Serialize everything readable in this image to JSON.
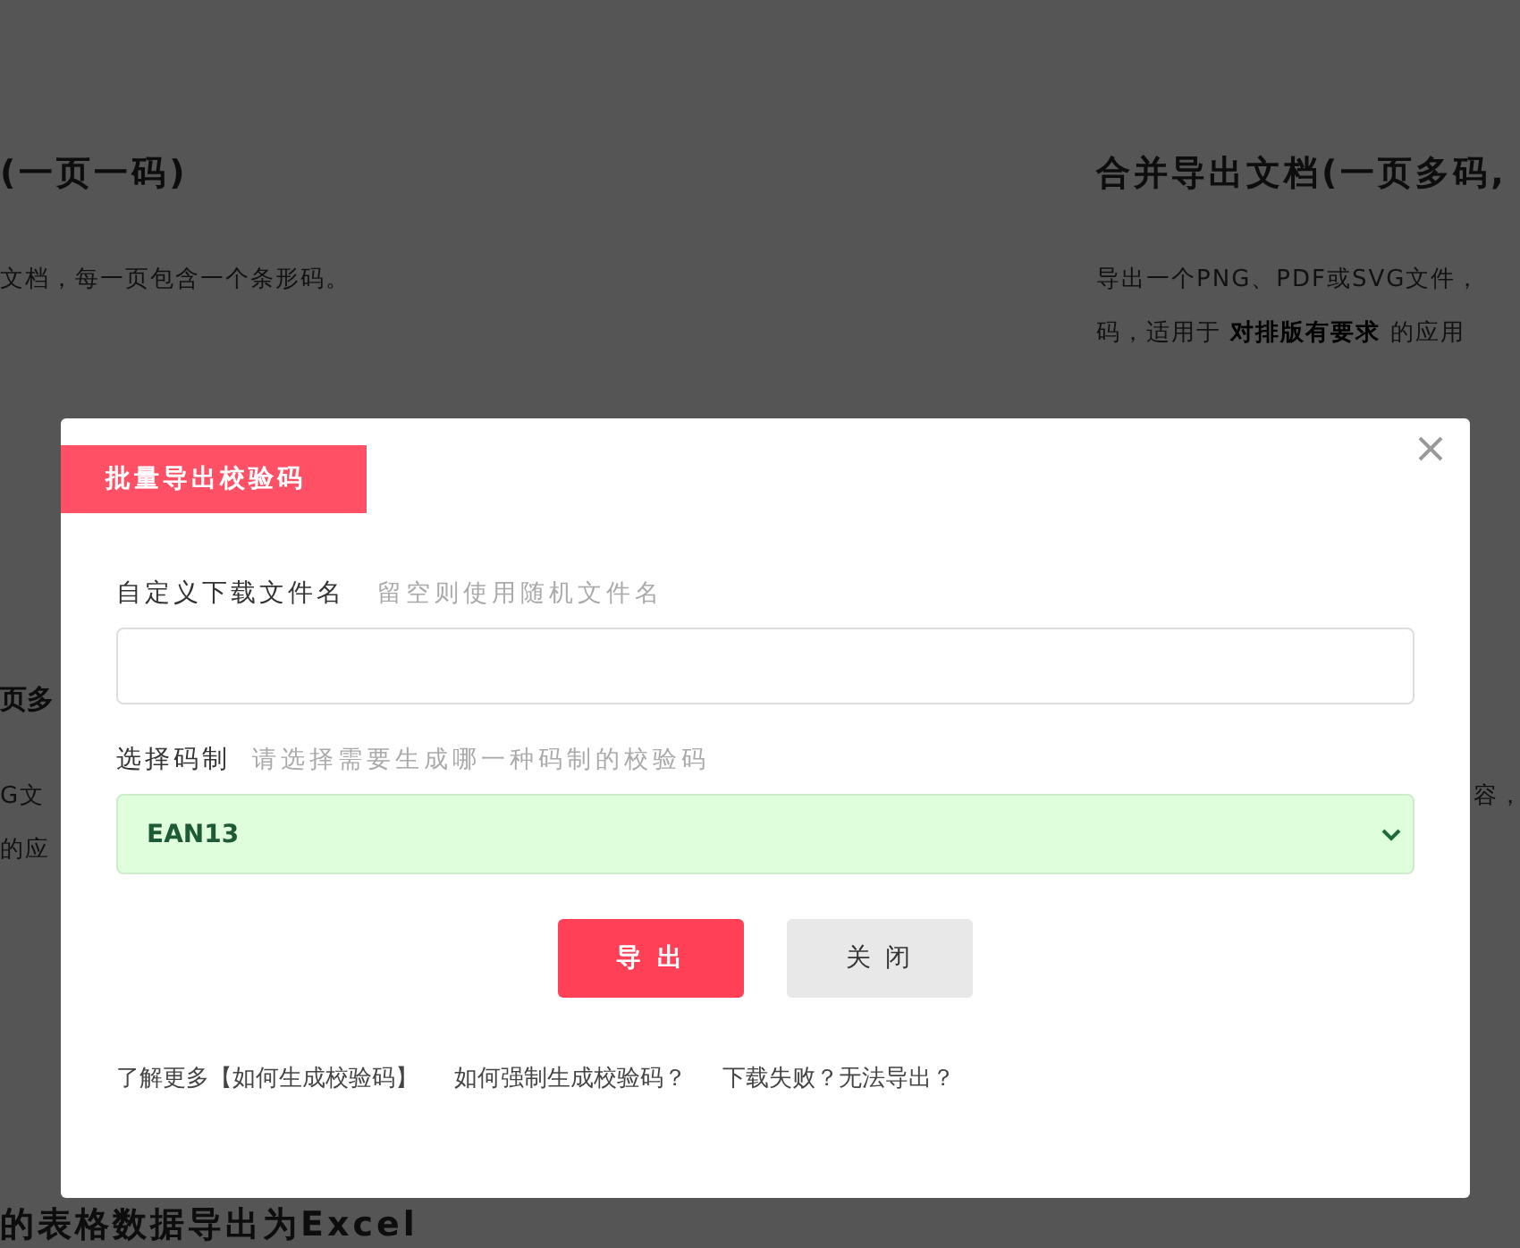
{
  "background": {
    "left_title": "(一页一码)",
    "left_desc": "文档，每一页包含一个条形码。",
    "right_title": "合并导出文档(一页多码,",
    "right_desc_lines": [
      "导出一个PNG、PDF或SVG文件，",
      "码，适用于 **对排版有要求** 的应用"
    ],
    "left_title_2": "页多",
    "left_desc_2_lines": [
      "G文",
      "的应"
    ],
    "right_desc_2": "容，",
    "bottom_title": "的表格数据导出为Excel"
  },
  "dialog": {
    "title": "批量导出校验码",
    "filename_label": "自定义下载文件名",
    "filename_hint": "留空则使用随机文件名",
    "codetype_label": "选择码制",
    "codetype_hint": "请选择需要生成哪一种码制的校验码",
    "codetype_value": "EAN13",
    "buttons": [
      {
        "label": "导 出",
        "kind": "primary"
      },
      {
        "label": "关 闭",
        "kind": "secondary"
      }
    ],
    "links": [
      "了解更多【如何生成校验码】",
      "如何强制生成校验码？",
      "下载失败？无法导出？"
    ]
  }
}
